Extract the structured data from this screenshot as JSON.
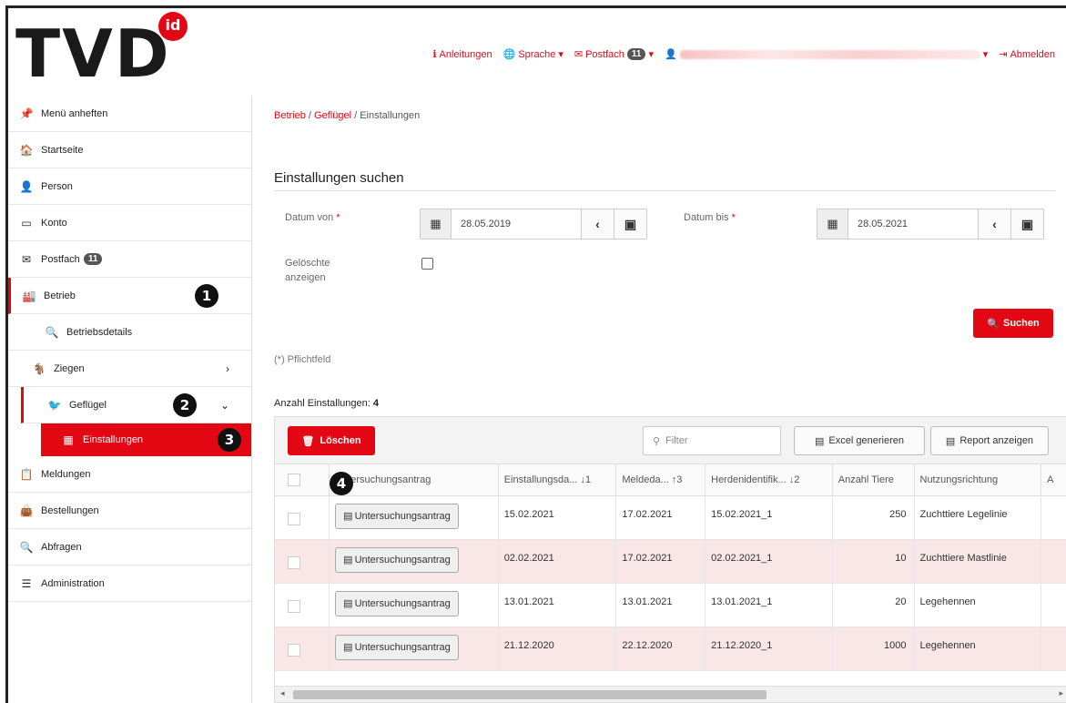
{
  "header": {
    "logo": "TVD",
    "logo_badge": "id",
    "nav": {
      "anleitungen": "Anleitungen",
      "sprache": "Sprache",
      "postfach": "Postfach",
      "postfach_count": "11",
      "abmelden": "Abmelden"
    }
  },
  "sidebar": {
    "pin": "Menü anheften",
    "startseite": "Startseite",
    "person": "Person",
    "konto": "Konto",
    "postfach": "Postfach",
    "postfach_count": "11",
    "betrieb": "Betrieb",
    "betriebsdetails": "Betriebsdetails",
    "ziegen": "Ziegen",
    "gefluegel": "Geflügel",
    "einstallungen": "Einstallungen",
    "meldungen": "Meldungen",
    "bestellungen": "Bestellungen",
    "abfragen": "Abfragen",
    "administration": "Administration"
  },
  "annotations": [
    "1",
    "2",
    "3",
    "4"
  ],
  "breadcrumb": {
    "betrieb": "Betrieb",
    "gefluegel": "Geflügel",
    "current": "Einstallungen",
    "sep": "/"
  },
  "search": {
    "title": "Einstallungen suchen",
    "datum_von_label": "Datum von",
    "datum_von": "28.05.2019",
    "datum_bis_label": "Datum bis",
    "datum_bis": "28.05.2021",
    "required_mark": "*",
    "geloeschte_label_1": "Gelöschte",
    "geloeschte_label_2": "anzeigen",
    "button": "Suchen",
    "pflichtfeld": "(*) Pflichtfeld"
  },
  "results": {
    "count_label": "Anzahl Einstallungen:",
    "count": "4",
    "delete_button": "Löschen",
    "filter_placeholder": "Filter",
    "excel_button": "Excel generieren",
    "report_button": "Report anzeigen",
    "columns": [
      "Untersuchungsantrag",
      "Einstallungsda... ↓1",
      "Meldeda... ↑3",
      "Herdenidentifik... ↓2",
      "Anzahl Tiere",
      "Nutzungsrichtung",
      "A"
    ],
    "antrag_label": "Untersuchungsantrag",
    "rows": [
      {
        "einstallung": "15.02.2021",
        "meldedatum": "17.02.2021",
        "herde": "15.02.2021_1",
        "anzahl": "250",
        "nutzung": "Zuchttiere Legelinie"
      },
      {
        "einstallung": "02.02.2021",
        "meldedatum": "17.02.2021",
        "herde": "02.02.2021_1",
        "anzahl": "10",
        "nutzung": "Zuchttiere Mastlinie"
      },
      {
        "einstallung": "13.01.2021",
        "meldedatum": "13.01.2021",
        "herde": "13.01.2021_1",
        "anzahl": "20",
        "nutzung": "Legehennen"
      },
      {
        "einstallung": "21.12.2020",
        "meldedatum": "22.12.2020",
        "herde": "21.12.2020_1",
        "anzahl": "1000",
        "nutzung": "Legehennen"
      }
    ]
  },
  "colors": {
    "accent": "#e30613",
    "row_alt": "#f9e6e6"
  }
}
